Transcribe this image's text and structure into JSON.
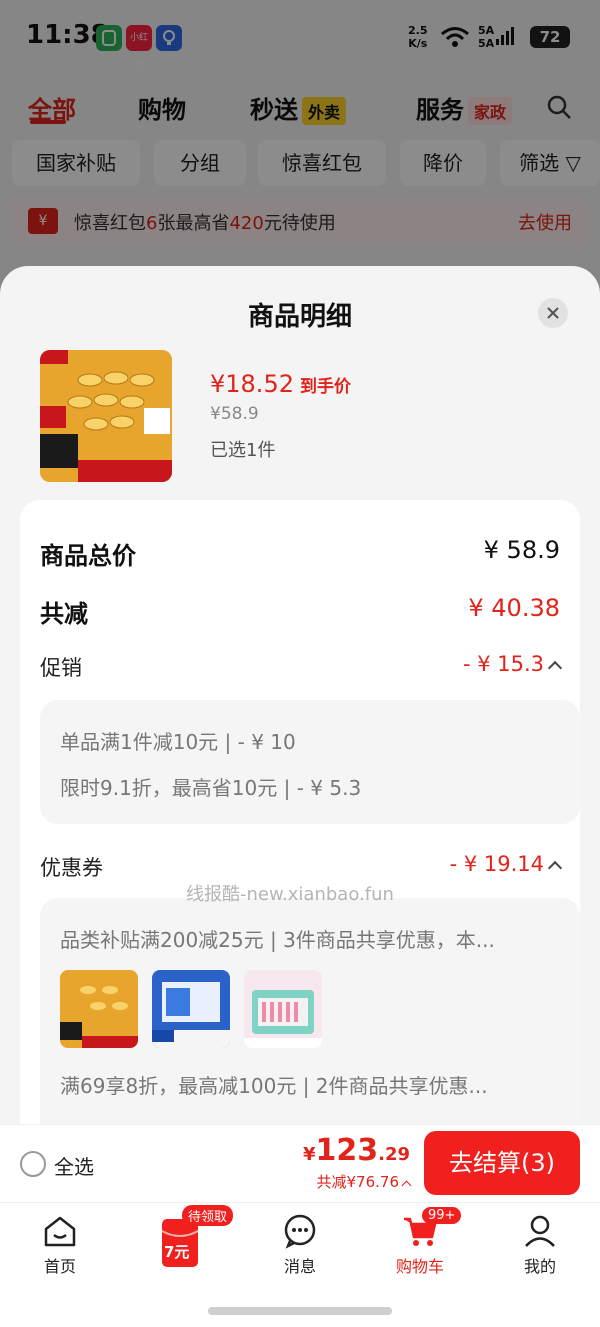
{
  "status": {
    "time": "11:38",
    "net_speed_top": "2.5",
    "net_speed_unit": "K/s",
    "sig_top": "5A",
    "sig_bottom": "5A",
    "battery": "72",
    "app_icon_2": "小红书"
  },
  "top_tabs": [
    {
      "label": "全部"
    },
    {
      "label": "购物"
    },
    {
      "label": "秒送",
      "badge": "外卖"
    },
    {
      "label": "服务",
      "badge": "家政"
    }
  ],
  "chips": [
    "国家补贴",
    "分组",
    "惊喜红包",
    "降价",
    "筛选"
  ],
  "banner": {
    "prefix": "惊喜红包",
    "count": "6",
    "mid": "张最高省",
    "amount": "420",
    "suffix": "元待使用",
    "link": "去使用"
  },
  "sheet": {
    "title": "商品明细",
    "product": {
      "price": "¥18.52",
      "price_label": "到手价",
      "original": "¥58.9",
      "selected": "已选1件"
    },
    "total_label": "商品总价",
    "total_value": "¥ 58.9",
    "reduce_label": "共减",
    "reduce_value": "¥ 40.38",
    "promo_label": "促销",
    "promo_value": "- ¥ 15.3",
    "promo_lines": [
      "单品满1件减10元 | - ¥ 10",
      "限时9.1折，最高省10元 | - ¥ 5.3"
    ],
    "coupon_label": "优惠券",
    "coupon_value": "- ¥ 19.14",
    "coupon_lines": [
      "品类补贴满200减25元 | 3件商品共享优惠，本...",
      "满69享8折，最高减100元 | 2件商品共享优惠..."
    ],
    "watermark": "线报酷-new.xianbao.fun"
  },
  "checkout": {
    "select_all": "全选",
    "yen": "¥",
    "total_int": "123",
    "total_dec": ".29",
    "discount": "共减¥76.76",
    "pay_button": "去结算(3)"
  },
  "tabbar": {
    "items": [
      {
        "label": "首页",
        "icon": "home-icon"
      },
      {
        "label": "",
        "icon": "red-packet-icon",
        "badge": "待领取",
        "packet_text": "7元"
      },
      {
        "label": "消息",
        "icon": "message-icon"
      },
      {
        "label": "购物车",
        "icon": "cart-icon",
        "badge": "99+"
      },
      {
        "label": "我的",
        "icon": "profile-icon"
      }
    ]
  },
  "colors": {
    "accent": "#e2231a",
    "button": "#f0201e",
    "background": "#f4f4f4"
  }
}
